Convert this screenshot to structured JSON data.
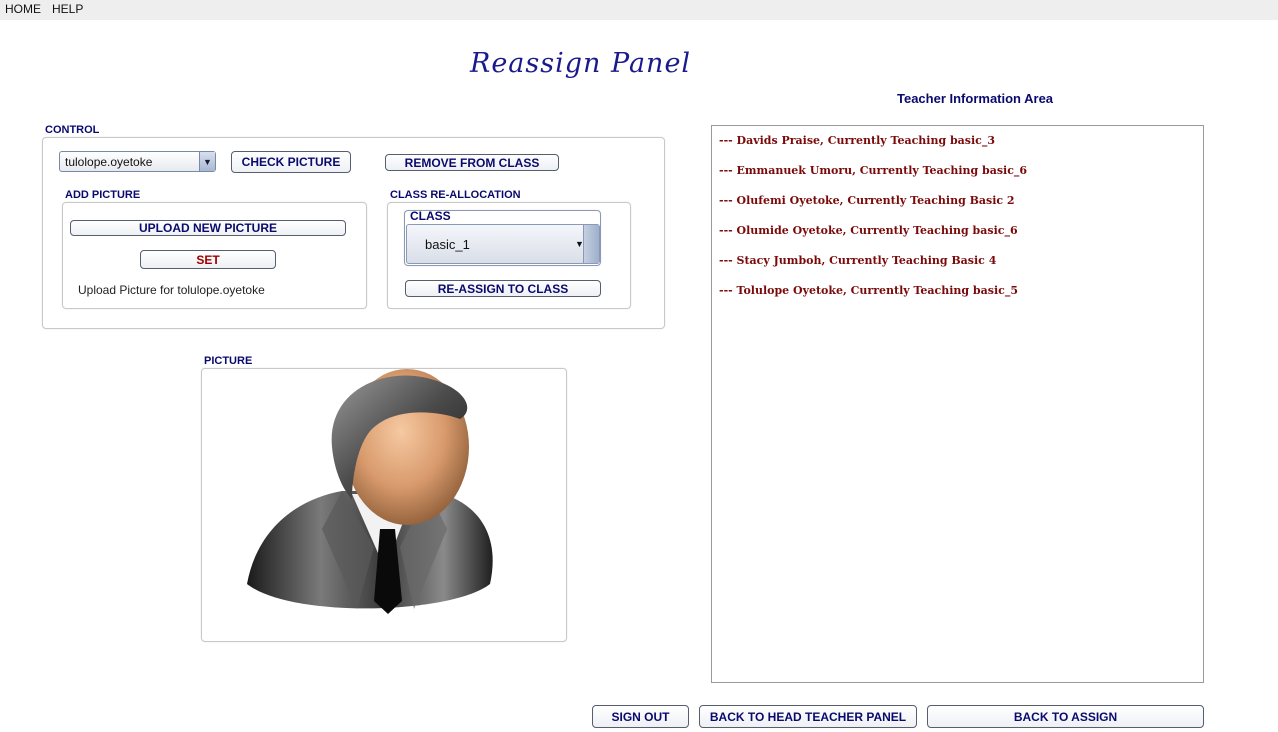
{
  "menu": {
    "home": "HOME",
    "help": "HELP"
  },
  "title": "Reassign Panel",
  "control": {
    "label": "CONTROL",
    "teacher_select_value": "tulolope.oyetoke",
    "check_picture": "CHECK PICTURE",
    "remove_from_class": "REMOVE FROM CLASS"
  },
  "add_picture": {
    "label": "ADD PICTURE",
    "upload_button": "UPLOAD NEW PICTURE",
    "set_button": "SET",
    "note": "Upload Picture for tolulope.oyetoke"
  },
  "class_reallocation": {
    "label": "CLASS RE-ALLOCATION",
    "class_label": "CLASS",
    "class_value": "basic_1",
    "reassign_button": "RE-ASSIGN TO CLASS"
  },
  "picture": {
    "label": "PICTURE",
    "icon": "user-avatar-icon"
  },
  "info_area": {
    "title": "Teacher Information Area",
    "lines": [
      "--- Davids Praise, Currently Teaching basic_3",
      "--- Emmanuek Umoru, Currently Teaching basic_6",
      "--- Olufemi Oyetoke, Currently Teaching Basic 2",
      "--- Olumide Oyetoke, Currently Teaching basic_6",
      "--- Stacy Jumboh, Currently Teaching Basic 4",
      "--- Tolulope Oyetoke, Currently Teaching basic_5"
    ]
  },
  "footer": {
    "sign_out": "SIGN OUT",
    "back_head_teacher": "BACK TO HEAD TEACHER PANEL",
    "back_assign": "BACK TO ASSIGN"
  },
  "colors": {
    "label_blue": "#0a0a6e",
    "title_blue": "#1a1a8c",
    "info_text": "#7a0a0a",
    "set_red": "#a00000"
  }
}
